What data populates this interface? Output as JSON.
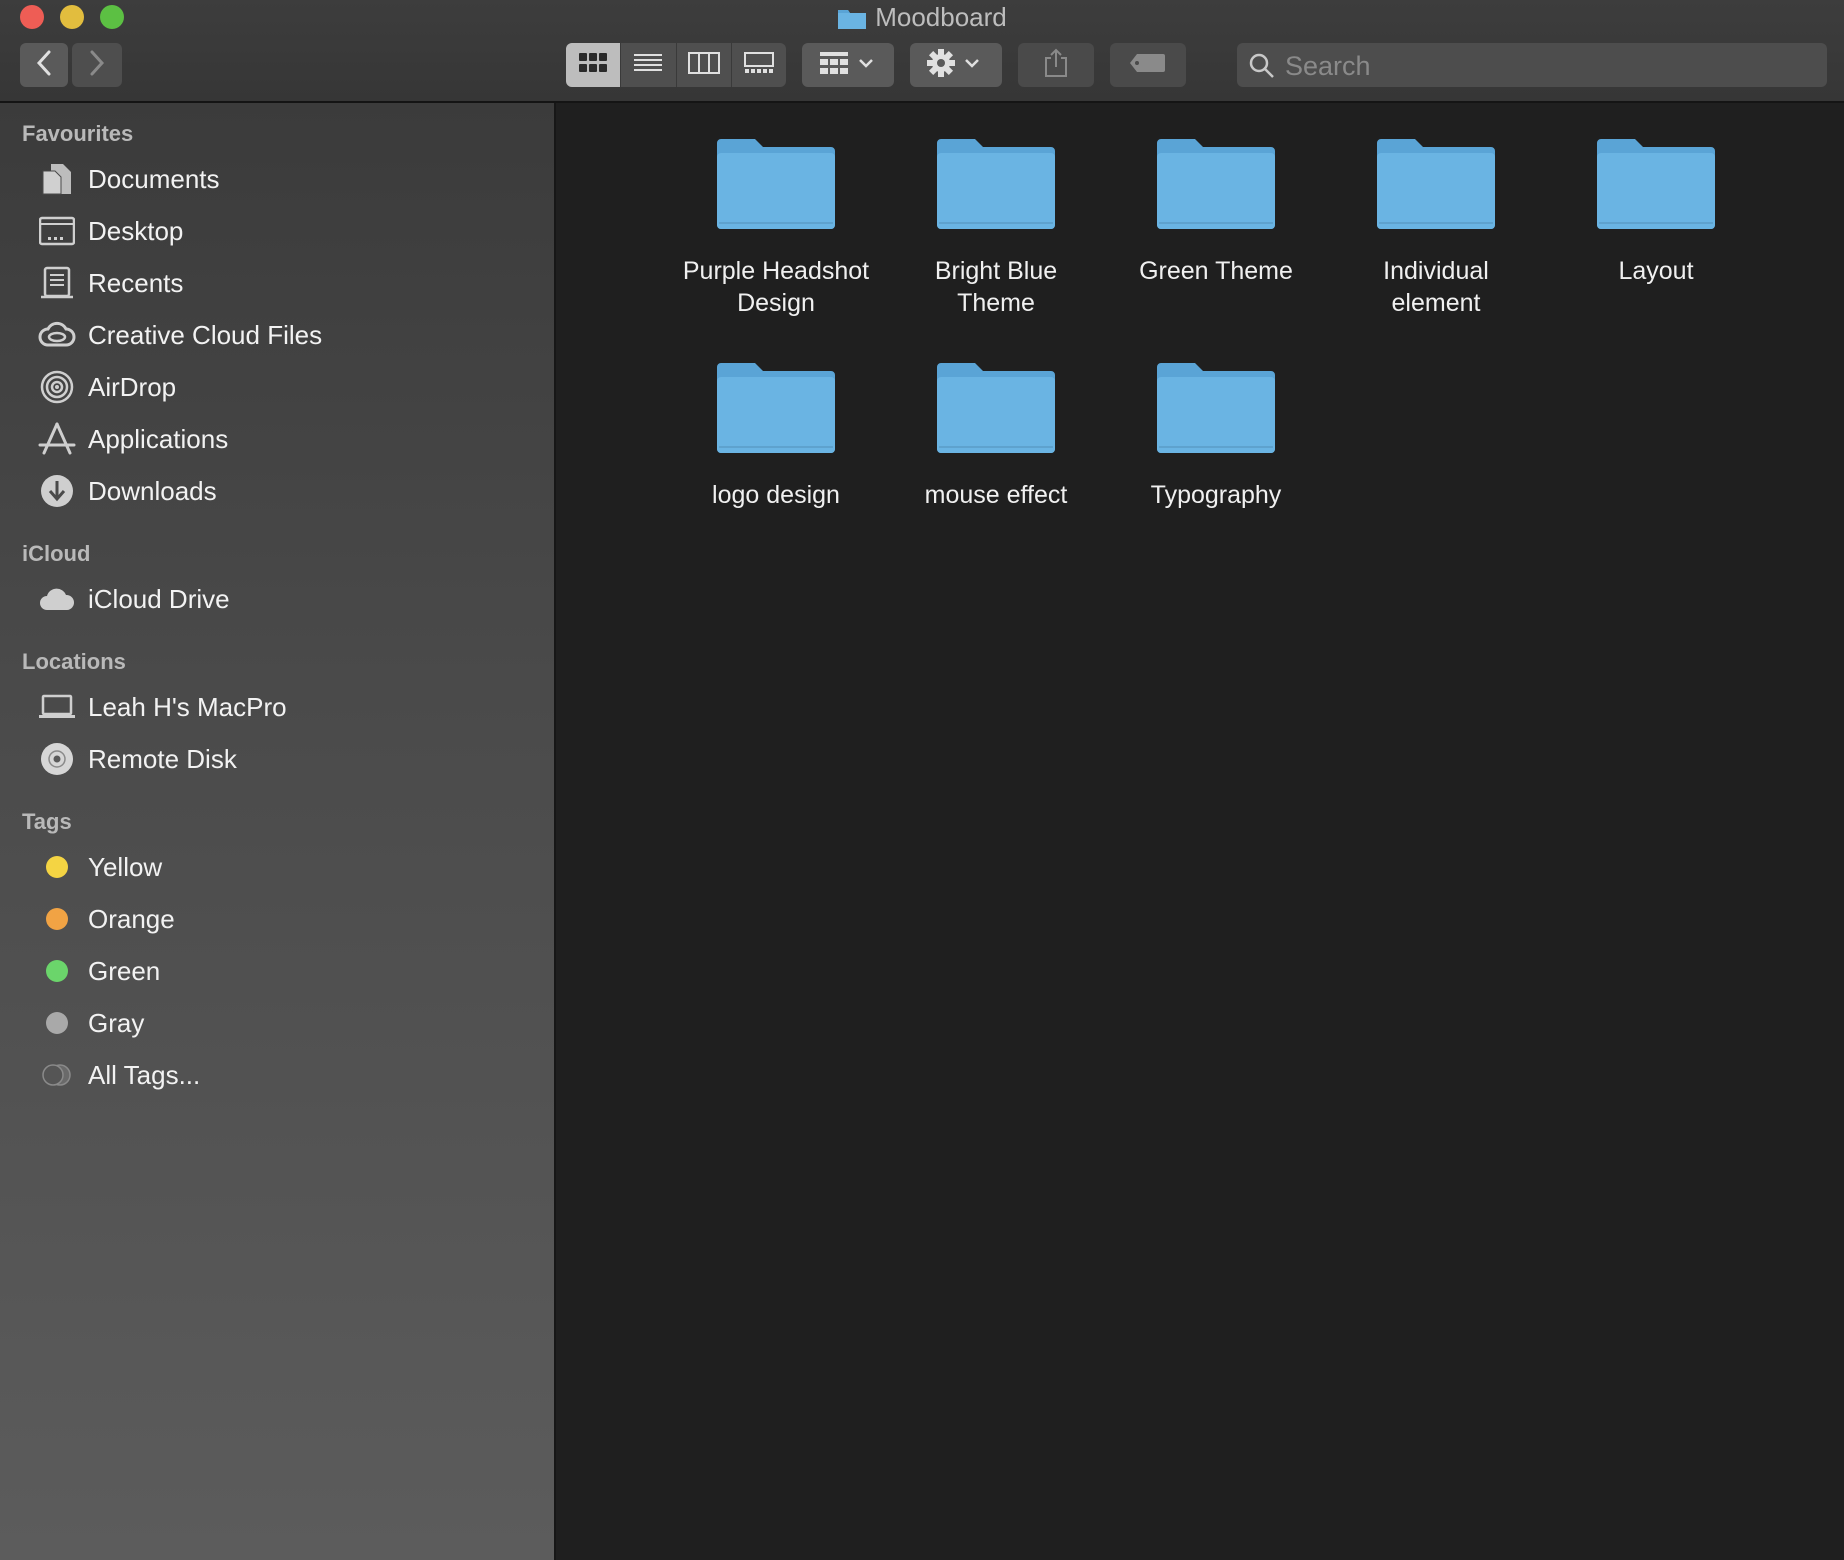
{
  "window": {
    "title": "Moodboard"
  },
  "toolbar": {
    "search_placeholder": "Search"
  },
  "sidebar": {
    "sections": {
      "favourites": "Favourites",
      "icloud": "iCloud",
      "locations": "Locations",
      "tags": "Tags"
    },
    "favourites": [
      {
        "label": "Documents",
        "icon": "documents-icon"
      },
      {
        "label": "Desktop",
        "icon": "desktop-icon"
      },
      {
        "label": "Recents",
        "icon": "recents-icon"
      },
      {
        "label": "Creative Cloud Files",
        "icon": "creative-cloud-icon"
      },
      {
        "label": "AirDrop",
        "icon": "airdrop-icon"
      },
      {
        "label": "Applications",
        "icon": "applications-icon"
      },
      {
        "label": "Downloads",
        "icon": "downloads-icon"
      }
    ],
    "icloud": [
      {
        "label": "iCloud Drive",
        "icon": "cloud-icon"
      }
    ],
    "locations": [
      {
        "label": "Leah H's MacPro",
        "icon": "laptop-icon"
      },
      {
        "label": "Remote Disk",
        "icon": "disc-icon"
      }
    ],
    "tags": [
      {
        "label": "Yellow",
        "color": "#f4d443"
      },
      {
        "label": "Orange",
        "color": "#f1a344"
      },
      {
        "label": "Green",
        "color": "#6bd56b"
      },
      {
        "label": "Gray",
        "color": "#a9a9a9"
      },
      {
        "label": "All Tags...",
        "color": "#5a5a5a"
      }
    ]
  },
  "folders": [
    {
      "name": "Purple Headshot Design"
    },
    {
      "name": "Bright Blue Theme"
    },
    {
      "name": "Green Theme"
    },
    {
      "name": "Individual element"
    },
    {
      "name": "Layout"
    },
    {
      "name": "logo design"
    },
    {
      "name": "mouse effect"
    },
    {
      "name": "Typography"
    }
  ],
  "colors": {
    "folder": "#6ab4e3",
    "folder_tab": "#5aa4d6"
  }
}
